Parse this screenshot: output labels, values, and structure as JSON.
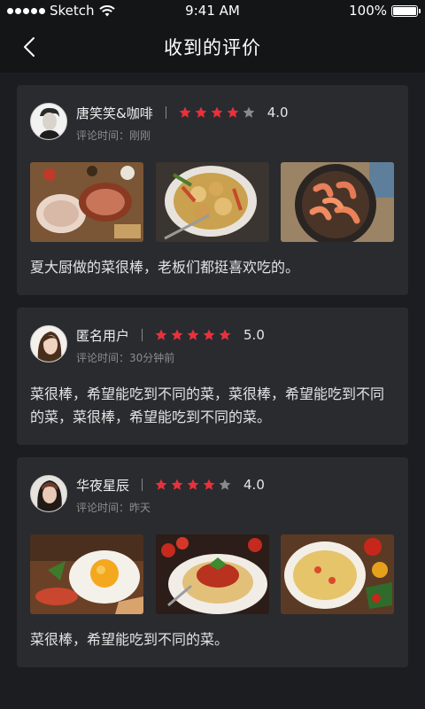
{
  "status_bar": {
    "carrier": "Sketch",
    "time": "9:41 AM",
    "battery": "100%",
    "battery_level": 1.0
  },
  "nav": {
    "title": "收到的评价",
    "back_icon": "chevron-left-icon"
  },
  "reviews": [
    {
      "user": "唐笑笑&咖啡",
      "rating_text": "4.0",
      "rating": 4,
      "time_label": "评论时间：刚刚",
      "photos": [
        "roast-meat-photo",
        "roasted-potatoes-photo",
        "shrimp-pan-photo"
      ],
      "comment": "夏大厨做的菜很棒，老板们都挺喜欢吃的。"
    },
    {
      "user": "匿名用户",
      "rating_text": "5.0",
      "rating": 5,
      "time_label": "评论时间：30分钟前",
      "comment": "菜很棒，希望能吃到不同的菜，菜很棒，希望能吃到不同的菜，菜很棒，希望能吃到不同的菜。"
    },
    {
      "user": "华夜星辰",
      "rating_text": "4.0",
      "rating": 4,
      "time_label": "评论时间：昨天",
      "photos": [
        "fried-egg-photo",
        "spaghetti-photo",
        "pasta-dish-photo"
      ],
      "comment": "菜很棒，希望能吃到不同的菜。"
    }
  ],
  "colors": {
    "star_active": "#e8313a",
    "star_inactive": "#8a8a8a",
    "card_bg": "#2a2b2f",
    "page_bg": "#1c1d20"
  }
}
